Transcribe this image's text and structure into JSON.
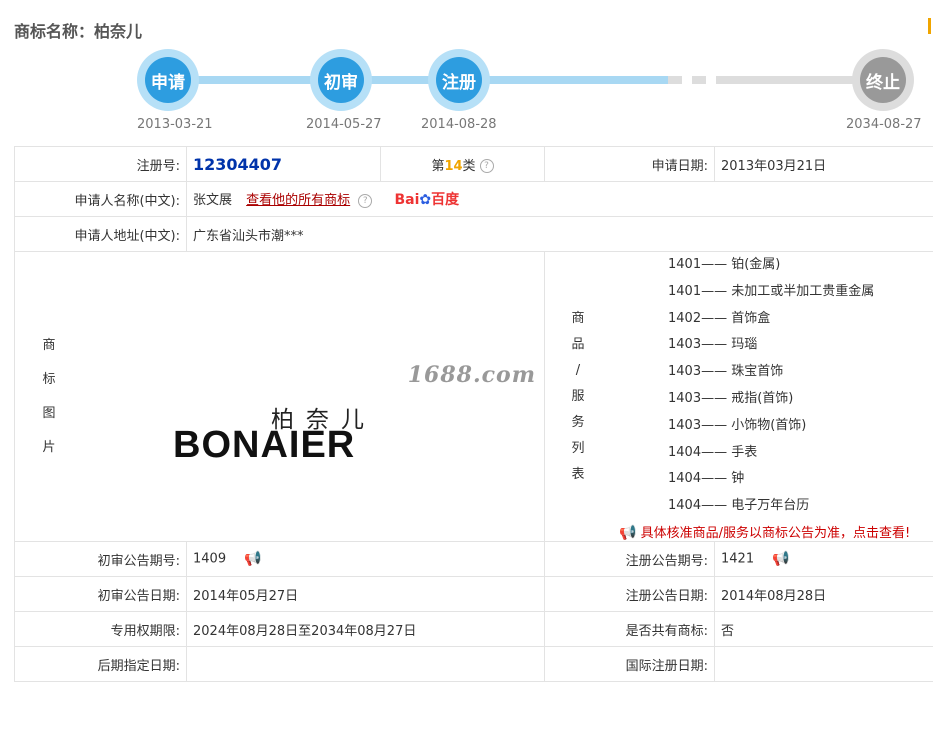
{
  "header": {
    "title": "商标名称：柏奈儿"
  },
  "timeline": [
    {
      "label": "申请",
      "date": "2013-03-21"
    },
    {
      "label": "初审",
      "date": "2014-05-27"
    },
    {
      "label": "注册",
      "date": "2014-08-28"
    },
    {
      "label": "终止",
      "date": "2034-08-27"
    }
  ],
  "info": {
    "reg_no_label": "注册号:",
    "reg_no": "12304407",
    "class_prefix": "第",
    "class_num": "14",
    "class_suffix": "类",
    "apply_date_label": "申请日期:",
    "apply_date": "2013年03月21日",
    "applicant_label": "申请人名称(中文):",
    "applicant": "张文展",
    "all_marks_link": "查看他的所有商标",
    "baidu_a": "Bai",
    "baidu_b": "百度",
    "address_label": "申请人地址(中文):",
    "address": "广东省汕头市潮***",
    "image_label": [
      "商",
      "标",
      "图",
      "片"
    ],
    "watermark": "1688.com",
    "logo_cn": "柏奈儿",
    "logo_en": "BONAIER",
    "goods_label": [
      "商",
      "品",
      "/",
      "服",
      "务",
      "列",
      "表"
    ],
    "goods": [
      "1401—— 铂(金属)",
      "1401—— 未加工或半加工贵重金属",
      "1402—— 首饰盒",
      "1403—— 玛瑙",
      "1403—— 珠宝首饰",
      "1403—— 戒指(首饰)",
      "1403—— 小饰物(首饰)",
      "1404—— 手表",
      "1404—— 钟",
      "1404—— 电子万年台历"
    ],
    "goods_notice": "具体核准商品/服务以商标公告为准，点击查看!",
    "prelim_no_label": "初审公告期号:",
    "prelim_no": "1409",
    "reg_pub_no_label": "注册公告期号:",
    "reg_pub_no": "1421",
    "prelim_date_label": "初审公告日期:",
    "prelim_date": "2014年05月27日",
    "reg_pub_date_label": "注册公告日期:",
    "reg_pub_date": "2014年08月28日",
    "term_label": "专用权期限:",
    "term": "2024年08月28日至2034年08月27日",
    "shared_label": "是否共有商标:",
    "shared": "否",
    "later_label": "后期指定日期:",
    "later": "",
    "intl_label": "国际注册日期:",
    "intl": ""
  }
}
